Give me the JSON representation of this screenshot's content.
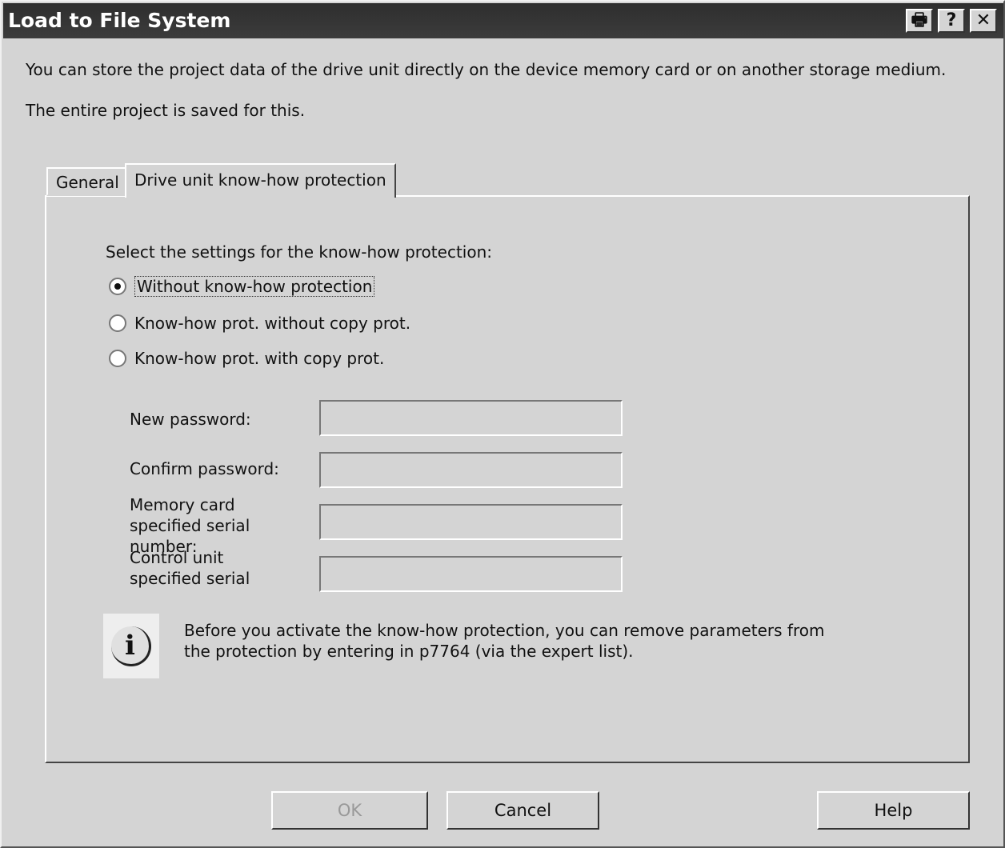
{
  "window": {
    "title": "Load to File System",
    "print_icon": "printer-icon",
    "help_icon": "question-icon",
    "close_icon": "close-icon"
  },
  "intro": [
    "You can store the project data of the drive unit directly on the device memory card or on another storage medium.",
    "The entire project is saved for this."
  ],
  "tabs": [
    {
      "label": "General",
      "active": false
    },
    {
      "label": "Drive unit know-how protection",
      "active": true
    }
  ],
  "protection": {
    "prompt": "Select the settings for the know-how protection:",
    "options": [
      {
        "label": "Without know-how protection",
        "selected": true
      },
      {
        "label": "Know-how prot. without copy prot.",
        "selected": false
      },
      {
        "label": "Know-how prot. with copy prot.",
        "selected": false
      }
    ],
    "fields": [
      {
        "label": "New password:",
        "value": ""
      },
      {
        "label": "Confirm password:",
        "value": ""
      },
      {
        "label": "Memory card specified serial number:",
        "value": ""
      },
      {
        "label": "Control unit specified serial",
        "value": ""
      }
    ],
    "info": "Before you activate the know-how protection, you can remove parameters from the protection by entering in p7764 (via the expert list)."
  },
  "buttons": {
    "ok": "OK",
    "cancel": "Cancel",
    "help": "Help"
  }
}
